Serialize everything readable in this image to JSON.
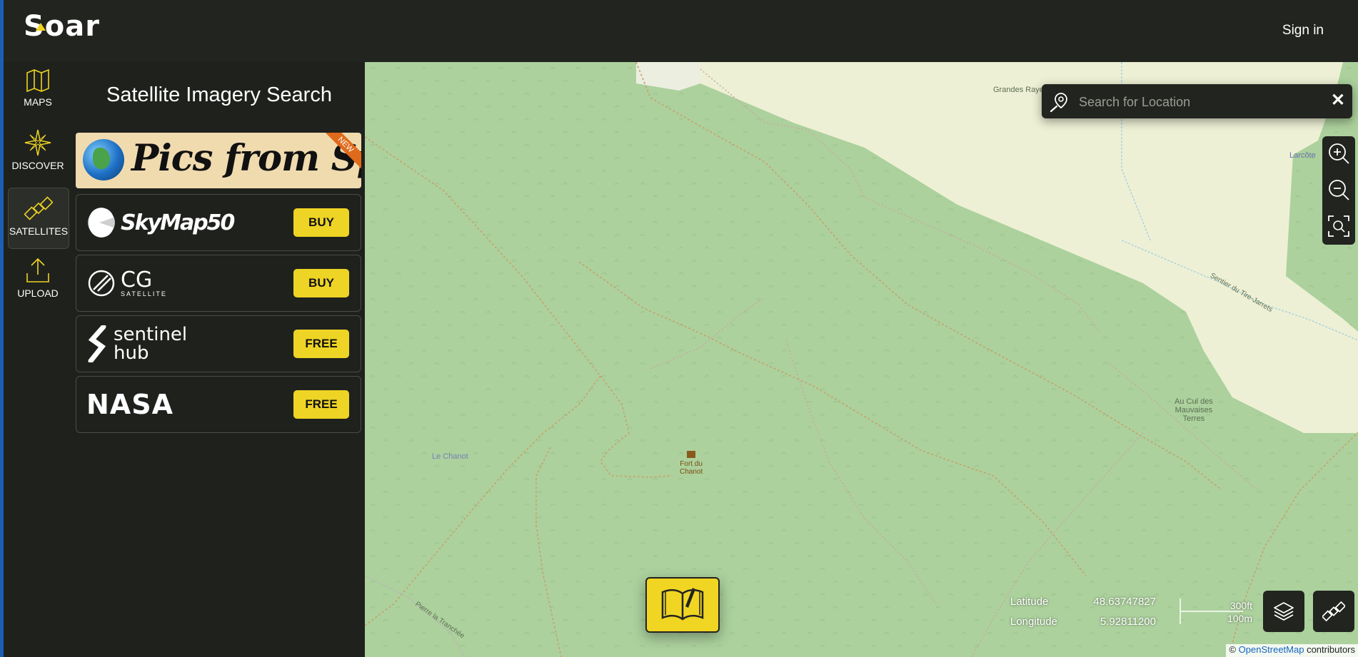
{
  "header": {
    "logo_text": "Soar",
    "signin_label": "Sign in"
  },
  "nav": {
    "items": [
      {
        "label": "MAPS",
        "icon": "map-icon"
      },
      {
        "label": "DISCOVER",
        "icon": "compass-star-icon"
      },
      {
        "label": "SATELLITES",
        "icon": "satellite-icon",
        "active": true
      },
      {
        "label": "UPLOAD",
        "icon": "upload-icon"
      }
    ]
  },
  "panel": {
    "title": "Satellite Imagery Search",
    "banner": {
      "text": "Pics from Space",
      "badge": "NEW"
    },
    "providers": [
      {
        "name": "SkyMap50",
        "button": "BUY"
      },
      {
        "name": "CG",
        "subname": "SATELLITE",
        "button": "BUY"
      },
      {
        "name": "sentinel",
        "subname": "hub",
        "button": "FREE"
      },
      {
        "name": "NASA",
        "button": "FREE"
      }
    ]
  },
  "map": {
    "search": {
      "placeholder": "Search for Location",
      "clear": "✕"
    },
    "labels": {
      "grandes_rayes": "Grandes Rayes",
      "larcote": "Larcôte",
      "le_chanot": "Le Chanot",
      "fort_line1": "Fort du",
      "fort_line2": "Chanot",
      "au_cul_1": "Au Cul des",
      "au_cul_2": "Mauvaises",
      "au_cul_3": "Terres",
      "sentier": "Sentier du Tire-Jarrets",
      "tranchee": "Pierre la Tranchée"
    },
    "coords": {
      "lat_label": "Latitude",
      "lat_value": "48.63747827",
      "lon_label": "Longitude",
      "lon_value": "5.92811200"
    },
    "scale": {
      "imperial": "300ft",
      "metric": "100m"
    },
    "attribution": {
      "prefix": "©",
      "link": "OpenStreetMap",
      "suffix": "contributors"
    },
    "colors": {
      "forest": "#acd19d",
      "meadow": "#eef0d5",
      "accent": "#eed424",
      "panel": "#1f211d"
    }
  }
}
